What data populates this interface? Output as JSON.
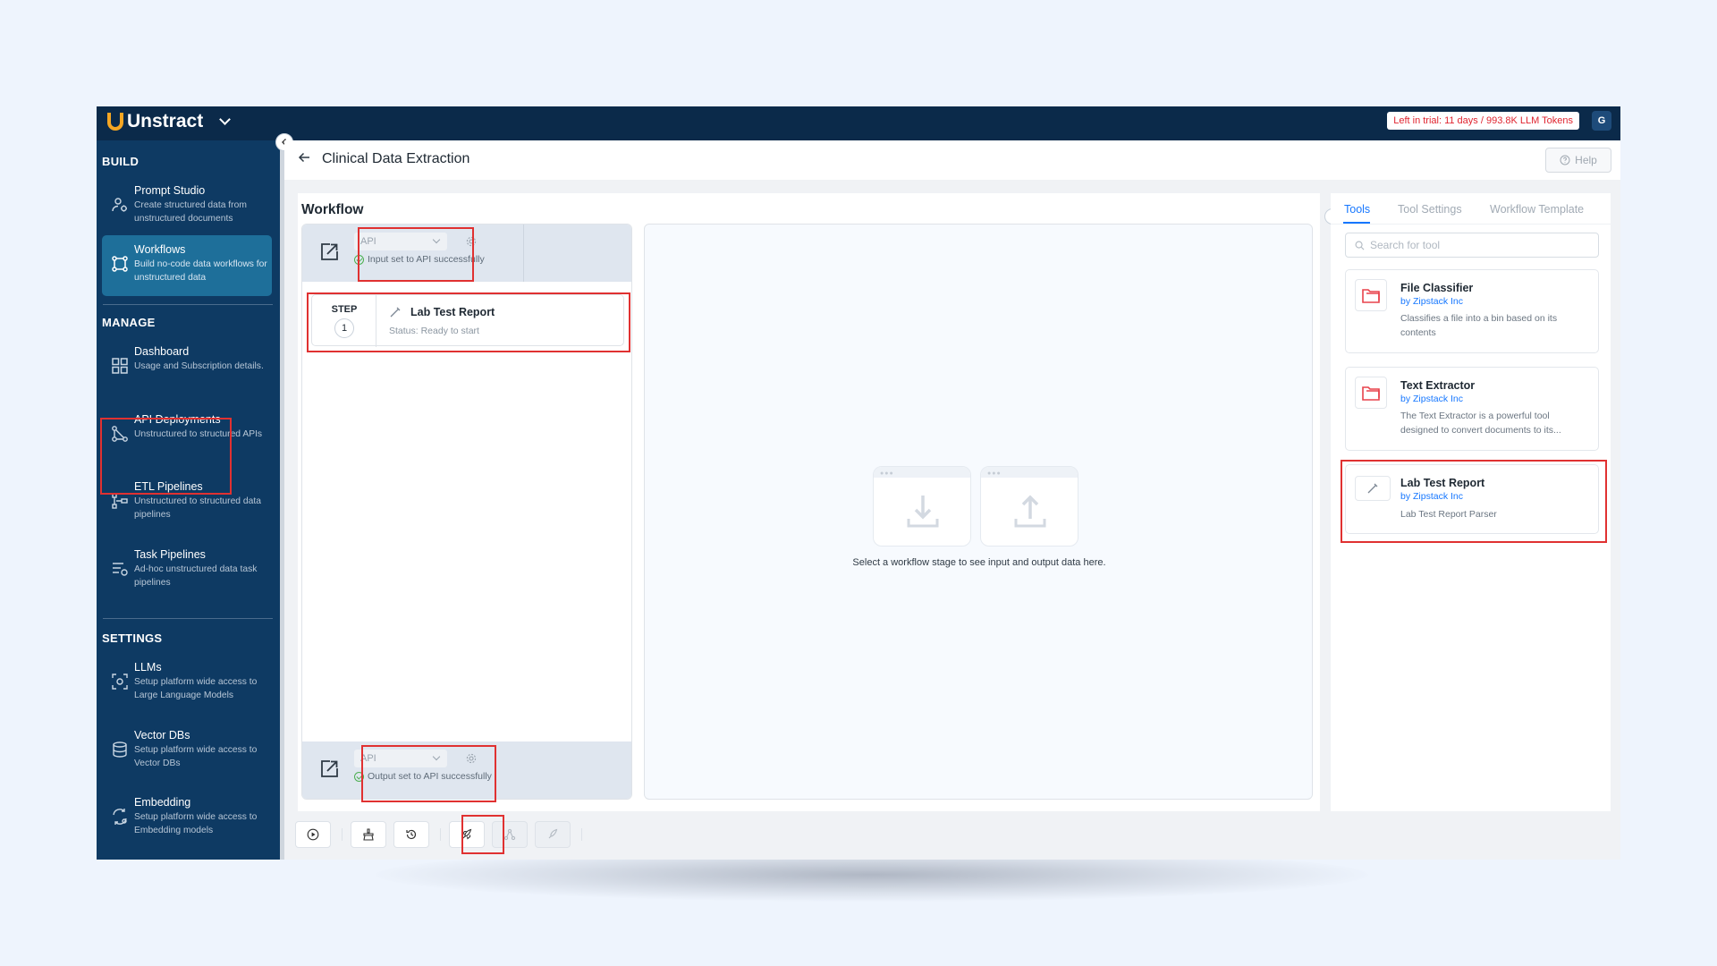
{
  "app": {
    "brand": "Unstract",
    "trial_notice": "Left in trial: 11 days / 993.8K LLM Tokens",
    "avatar_initial": "G"
  },
  "sidebar": {
    "sections": {
      "build": "BUILD",
      "manage": "MANAGE",
      "settings": "SETTINGS"
    },
    "items": [
      {
        "label": "Prompt Studio",
        "description": "Create structured data from unstructured documents",
        "icon": "prompt-studio-icon"
      },
      {
        "label": "Workflows",
        "description": "Build no-code data workflows for unstructured data",
        "icon": "workflows-icon",
        "active": true
      },
      {
        "label": "Dashboard",
        "description": "Usage and Subscription details.",
        "icon": "dashboard-icon"
      },
      {
        "label": "API Deployments",
        "description": "Unstructured to structured APIs",
        "icon": "api-deployments-icon"
      },
      {
        "label": "ETL Pipelines",
        "description": "Unstructured to structured data pipelines",
        "icon": "etl-pipelines-icon"
      },
      {
        "label": "Task Pipelines",
        "description": "Ad-hoc unstructured data task pipelines",
        "icon": "task-pipelines-icon"
      },
      {
        "label": "LLMs",
        "description": "Setup platform wide access to Large Language Models",
        "icon": "llms-icon"
      },
      {
        "label": "Vector DBs",
        "description": "Setup platform wide access to Vector DBs",
        "icon": "vector-db-icon"
      },
      {
        "label": "Embedding",
        "description": "Setup platform wide access to Embedding models",
        "icon": "embedding-icon"
      }
    ]
  },
  "header": {
    "title": "Clinical Data Extraction",
    "help_label": "Help"
  },
  "workflow": {
    "title": "Workflow",
    "input": {
      "type": "API",
      "status": "Input set to API successfully"
    },
    "output": {
      "type": "API",
      "status": "Output set to API successfully"
    },
    "step": {
      "word": "STEP",
      "number": "1",
      "name": "Lab Test Report",
      "status": "Status: Ready to start"
    },
    "io_hint": "Select a workflow stage to see input and output data here."
  },
  "tools_panel": {
    "tabs": [
      "Tools",
      "Tool Settings",
      "Workflow Template"
    ],
    "search_placeholder": "Search for tool",
    "tools": [
      {
        "name": "File Classifier",
        "by": "by Zipstack Inc",
        "description": "Classifies a file into a bin based on its contents"
      },
      {
        "name": "Text Extractor",
        "by": "by Zipstack Inc",
        "description": "The Text Extractor is a powerful tool designed to convert documents to its..."
      },
      {
        "name": "Lab Test Report",
        "by": "by Zipstack Inc",
        "description": "Lab Test Report Parser"
      }
    ]
  },
  "colors": {
    "topbar": "#0b2a4a",
    "sidebar": "#0e3a63",
    "sidebar_active": "#1e6f9a",
    "accent": "#1677ff",
    "highlight": "#e03131",
    "trial_text": "#e0242f"
  }
}
